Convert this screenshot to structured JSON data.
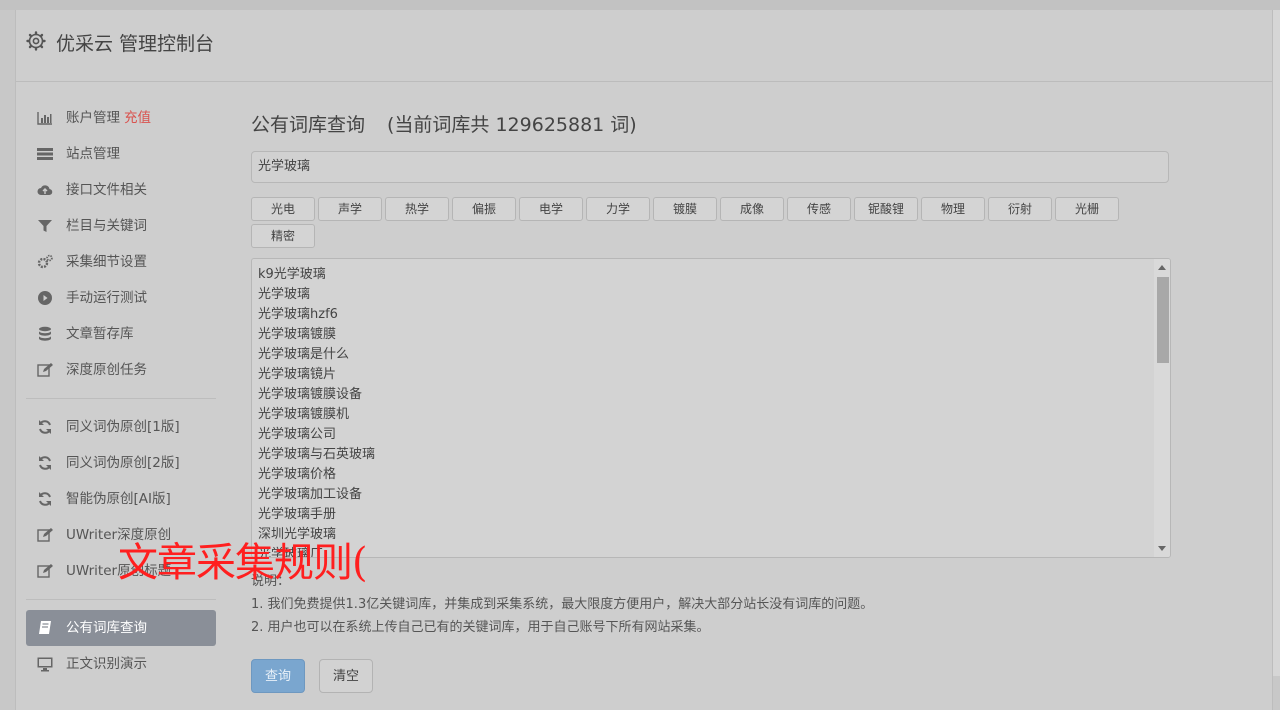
{
  "header": {
    "title": "优采云 管理控制台"
  },
  "sidebar": {
    "items": [
      {
        "label": "账户管理",
        "badge": "充值",
        "icon": "bar-chart-icon"
      },
      {
        "label": "站点管理",
        "icon": "list-icon"
      },
      {
        "label": "接口文件相关",
        "icon": "cloud-upload-icon"
      },
      {
        "label": "栏目与关键词",
        "icon": "filter-icon"
      },
      {
        "label": "采集细节设置",
        "icon": "gears-icon"
      },
      {
        "label": "手动运行测试",
        "icon": "play-icon"
      },
      {
        "label": "文章暂存库",
        "icon": "database-icon"
      },
      {
        "label": "深度原创任务",
        "icon": "edit-icon"
      },
      {
        "label": "同义词伪原创[1版]",
        "icon": "refresh-icon"
      },
      {
        "label": "同义词伪原创[2版]",
        "icon": "refresh-icon"
      },
      {
        "label": "智能伪原创[AI版]",
        "icon": "refresh-icon"
      },
      {
        "label": "UWriter深度原创",
        "icon": "edit-icon"
      },
      {
        "label": "UWriter原创标题",
        "icon": "edit-icon"
      },
      {
        "label": "公有词库查询",
        "icon": "book-icon"
      },
      {
        "label": "正文识别演示",
        "icon": "monitor-icon"
      }
    ]
  },
  "main": {
    "title": "公有词库查询",
    "count_text": "(当前词库共 129625881 词)",
    "search_value": "光学玻璃",
    "tags": [
      "光电",
      "声学",
      "热学",
      "偏振",
      "电学",
      "力学",
      "镀膜",
      "成像",
      "传感",
      "铌酸锂",
      "物理",
      "衍射",
      "光栅",
      "精密"
    ],
    "results": [
      "k9光学玻璃",
      "光学玻璃",
      "光学玻璃hzf6",
      "光学玻璃镀膜",
      "光学玻璃是什么",
      "光学玻璃镜片",
      "光学玻璃镀膜设备",
      "光学玻璃镀膜机",
      "光学玻璃公司",
      "光学玻璃与石英玻璃",
      "光学玻璃价格",
      "光学玻璃加工设备",
      "光学玻璃手册",
      "深圳光学玻璃",
      "光学玻璃厂"
    ],
    "notes_title": "说明：",
    "notes": [
      "1. 我们免费提供1.3亿关键词库，并集成到采集系统，最大限度方便用户，解决大部分站长没有词库的问题。",
      "2. 用户也可以在系统上传自己已有的关键词库，用于自己账号下所有网站采集。"
    ],
    "query_button": "查询",
    "clear_button": "清空"
  },
  "overlay": {
    "text": "文章采集规则("
  }
}
